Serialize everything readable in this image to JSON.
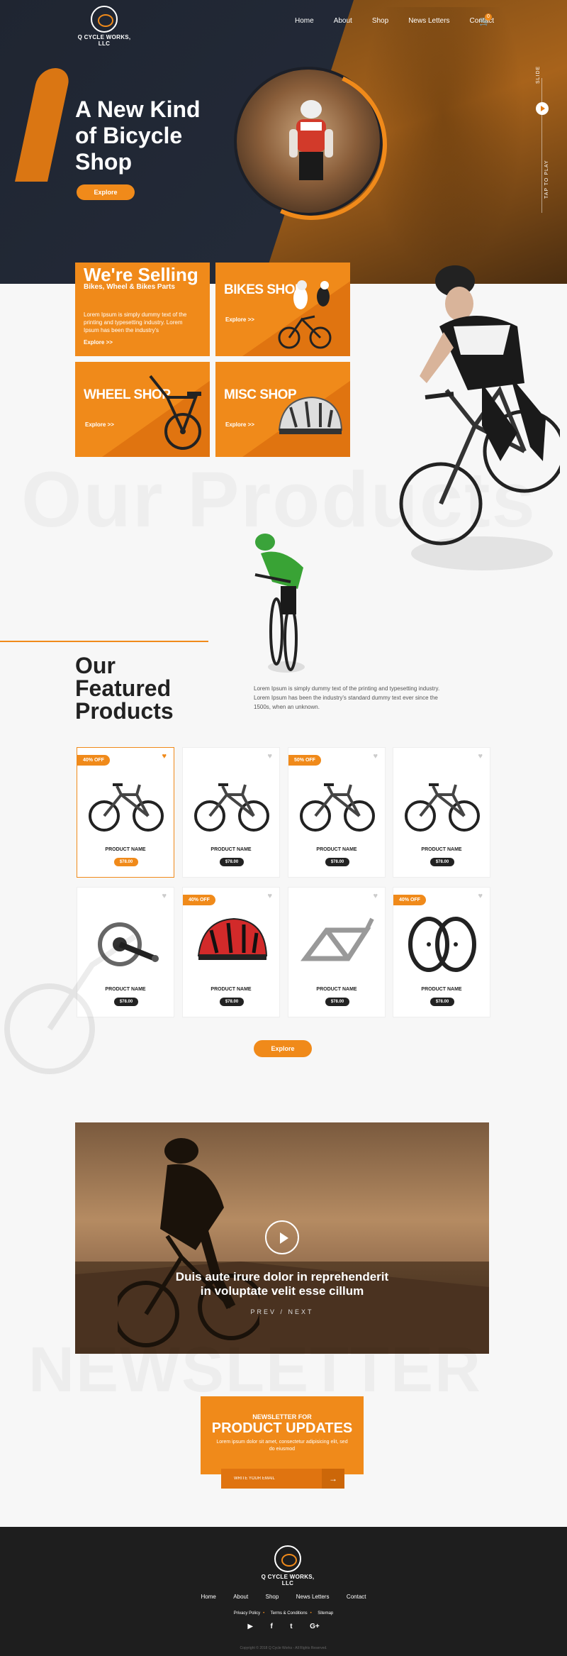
{
  "brand": {
    "name": "Q CYCLE WORKS, LLC"
  },
  "nav": {
    "items": [
      "Home",
      "About",
      "Shop",
      "News Letters",
      "Contact"
    ],
    "cart_count": "0"
  },
  "hero": {
    "title": "A New Kind of Bicycle Shop",
    "button": "Explore",
    "slide_label": "SLIDE",
    "tap_label": "TAP TO PLAY"
  },
  "categories": {
    "selling_title": "We're Selling",
    "selling_sub": "Bikes, Wheel & Bikes Parts",
    "selling_desc": "Lorem Ipsum is simply dummy text of the printing and typesetting industry. Lorem Ipsum has been the industry's",
    "selling_explore": "Explore >>",
    "bikes": {
      "title": "BIKES SHOP",
      "explore": "Explore >>"
    },
    "wheel": {
      "title": "WHEEL SHOP",
      "explore": "Explore >>"
    },
    "misc": {
      "title": "MISC SHOP",
      "explore": "Explore >>"
    }
  },
  "bg_text": {
    "products": "Our Products",
    "newsletter": "NEWSLETTER"
  },
  "featured": {
    "title": "Our Featured Products",
    "description": "Lorem Ipsum is simply dummy text of the printing and typesetting industry. Lorem Ipsum has been the industry's standard dummy text ever since the 1500s, when an unknown.",
    "explore": "Explore"
  },
  "products": [
    {
      "badge": "40% OFF",
      "name": "PRODUCT NAME",
      "price": "$78.00",
      "kind": "bike"
    },
    {
      "badge": "",
      "name": "PRODUCT NAME",
      "price": "$78.00",
      "kind": "bike"
    },
    {
      "badge": "50% OFF",
      "name": "PRODUCT NAME",
      "price": "$78.00",
      "kind": "bike"
    },
    {
      "badge": "",
      "name": "PRODUCT NAME",
      "price": "$78.00",
      "kind": "bike"
    },
    {
      "badge": "",
      "name": "PRODUCT NAME",
      "price": "$78.00",
      "kind": "crankset"
    },
    {
      "badge": "40% OFF",
      "name": "PRODUCT NAME",
      "price": "$78.00",
      "kind": "helmet"
    },
    {
      "badge": "",
      "name": "PRODUCT NAME",
      "price": "$78.00",
      "kind": "frame"
    },
    {
      "badge": "40% OFF",
      "name": "PRODUCT NAME",
      "price": "$78.00",
      "kind": "wheels"
    }
  ],
  "video": {
    "caption_line1": "Duis aute irure dolor in reprehenderit",
    "caption_line2": "in voluptate velit esse cillum",
    "prev_next": "PREV / NEXT"
  },
  "newsletter": {
    "kicker": "NEWSLETTER FOR",
    "title": "PRODUCT UPDATES",
    "desc": "Lorem ipsum dolor sit amet, consectetur adipisicing elit, sed do eiusmod",
    "placeholder": "WRITE YOUR EMAIL",
    "submit": "→"
  },
  "footer": {
    "nav": [
      "Home",
      "About",
      "Shop",
      "News Letters",
      "Contact"
    ],
    "links": [
      "Privacy Policy",
      "Terms & Conditions",
      "Sitemap"
    ],
    "socials": [
      "youtube-icon",
      "facebook-icon",
      "twitter-icon",
      "google-plus-icon"
    ],
    "copyright": "Copyright © 2018 Q Cycle Works - All Rights Reserved."
  },
  "colors": {
    "accent": "#f08a1a",
    "dark": "#1e1e1e",
    "hero_bg": "#1f2531"
  }
}
